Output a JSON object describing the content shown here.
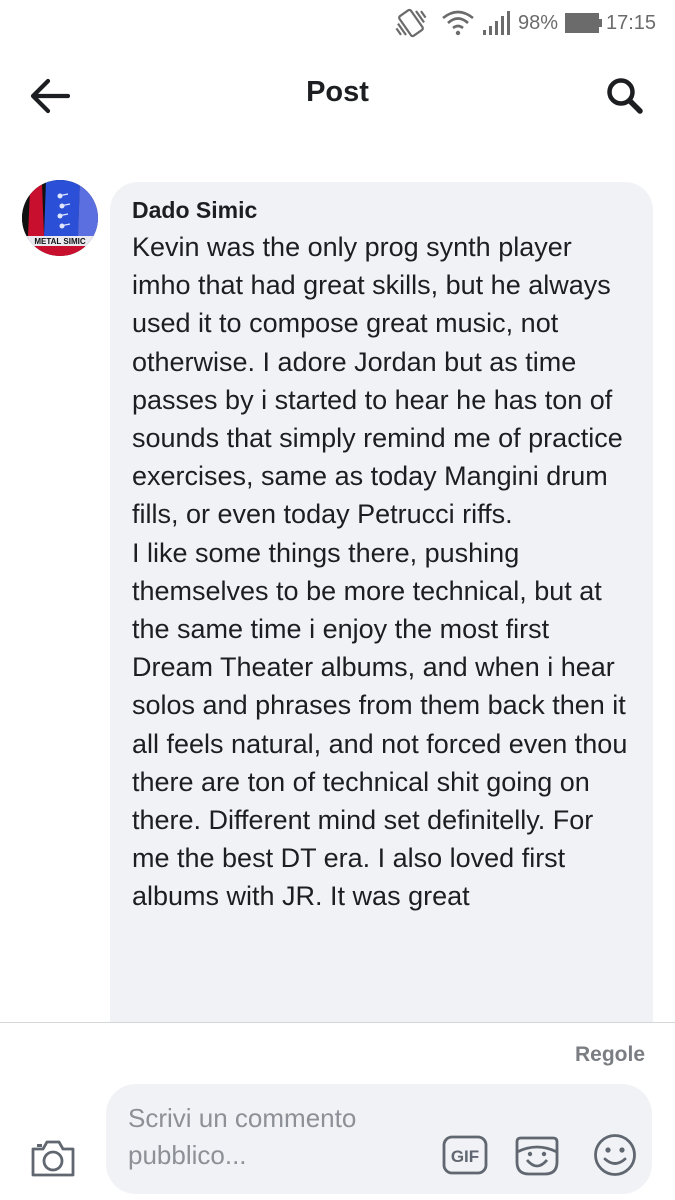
{
  "status_bar": {
    "battery": "98%",
    "time": "17:15",
    "icons": [
      "vibrate-icon",
      "wifi-icon",
      "signal-icon",
      "battery-icon"
    ]
  },
  "header": {
    "title": "Post",
    "back_icon": "back-arrow-icon",
    "search_icon": "search-icon"
  },
  "comment": {
    "author": "Dado Simic",
    "text": "Kevin was the only prog synth player imho that had great skills, but he always used it to compose great music, not otherwise. I adore Jordan but as time passes by i started to hear he has ton of sounds that simply remind me of practice exercises, same as today Mangini drum fills, or even today Petrucci riffs.\nI like some things there, pushing themselves to be more technical, but at the same time i enjoy the most first Dream Theater albums, and when i hear solos and phrases from them back then it all feels natural, and not forced even thou there are ton of technical shit going on there. Different mind set definitelly. For me the best DT era. I also loved first albums with JR. It was great",
    "avatar_label": "METAL SIMIC",
    "accent_colors": [
      "#2b4fd6",
      "#c8102e",
      "#111111"
    ]
  },
  "footer": {
    "rules": "Regole",
    "input_placeholder": "Scrivi un commento pubblico...",
    "gif_label": "GIF",
    "icons": [
      "camera-icon",
      "gif-icon",
      "sticker-icon",
      "emoji-icon"
    ]
  },
  "colors": {
    "bubble": "#f0f2f5",
    "text": "#1c1e21",
    "muted": "#8d9096"
  }
}
